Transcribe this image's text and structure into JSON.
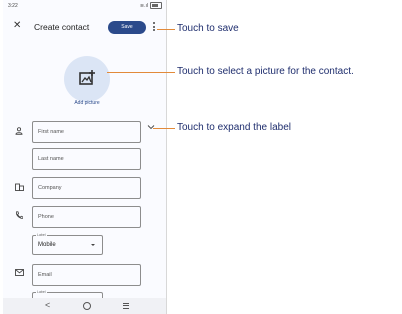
{
  "status": {
    "time": "3:22",
    "signal": "≋.ıl"
  },
  "appbar": {
    "title": "Create contact",
    "save_label": "Save"
  },
  "avatar": {
    "add_picture_label": "Add picture"
  },
  "fields": {
    "first_name": "First name",
    "last_name": "Last name",
    "company": "Company",
    "phone": "Phone",
    "phone_label_caption": "Label",
    "phone_label_value": "Mobile",
    "email": "Email",
    "email_label_caption": "Label"
  },
  "callouts": {
    "save": "Touch to save",
    "picture": "Touch to select a picture for the contact.",
    "expand": "Touch to expand the label"
  },
  "colors": {
    "accent": "#2b4a8b",
    "callout_text": "#1f2e6e",
    "callout_line": "#e28a3a"
  },
  "icons": [
    "close-icon",
    "more-vert-icon",
    "add-photo-icon",
    "person-icon",
    "chevron-down-icon",
    "business-icon",
    "phone-icon",
    "email-icon",
    "back-icon",
    "home-icon",
    "recents-icon"
  ]
}
